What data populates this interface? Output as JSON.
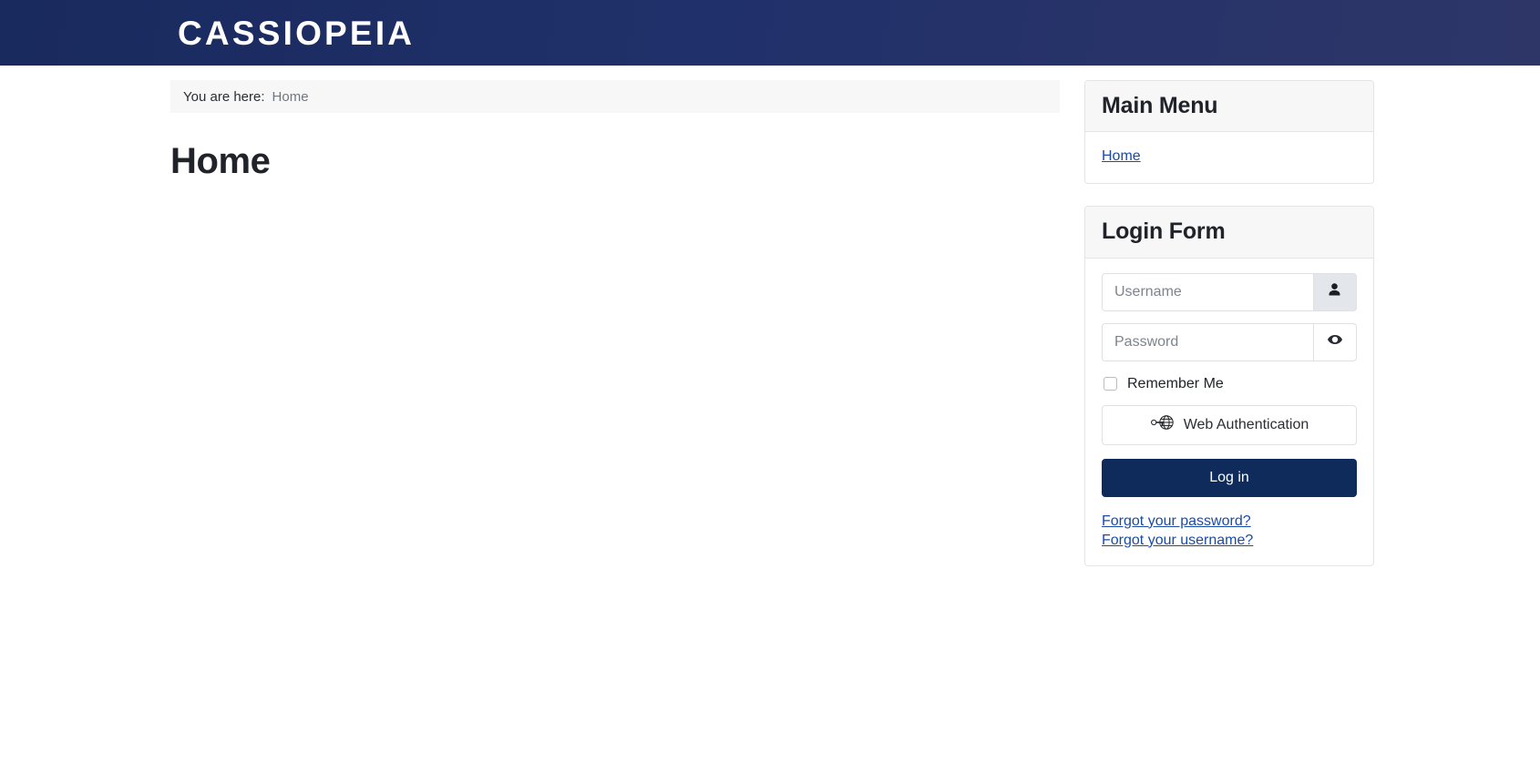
{
  "header": {
    "brand": "CASSIOPEIA",
    "gradient_from": "#192a5e",
    "gradient_to": "#2e3668"
  },
  "breadcrumb": {
    "label": "You are here:",
    "current": "Home"
  },
  "main": {
    "page_title": "Home"
  },
  "sidebar": {
    "main_menu": {
      "title": "Main Menu",
      "items": [
        {
          "label": "Home",
          "icon": "link-icon"
        }
      ]
    },
    "login_form": {
      "title": "Login Form",
      "username": {
        "placeholder": "Username",
        "value": "",
        "addon_icon": "user-icon"
      },
      "password": {
        "placeholder": "Password",
        "value": "",
        "addon_icon": "eye-icon"
      },
      "remember_me": {
        "label": "Remember Me",
        "checked": false
      },
      "webauthn_button": {
        "label": "Web Authentication",
        "icon": "passkey-globe-icon"
      },
      "login_button": {
        "label": "Log in",
        "color": "#0e2b5c"
      },
      "links": [
        {
          "label": "Forgot your password?"
        },
        {
          "label": "Forgot your username?"
        }
      ]
    }
  },
  "colors": {
    "link": "#1a4ba8",
    "panel_header_bg": "#f7f7f8",
    "border": "#e3e4e6",
    "breadcrumb_bg": "#f7f7f7"
  }
}
